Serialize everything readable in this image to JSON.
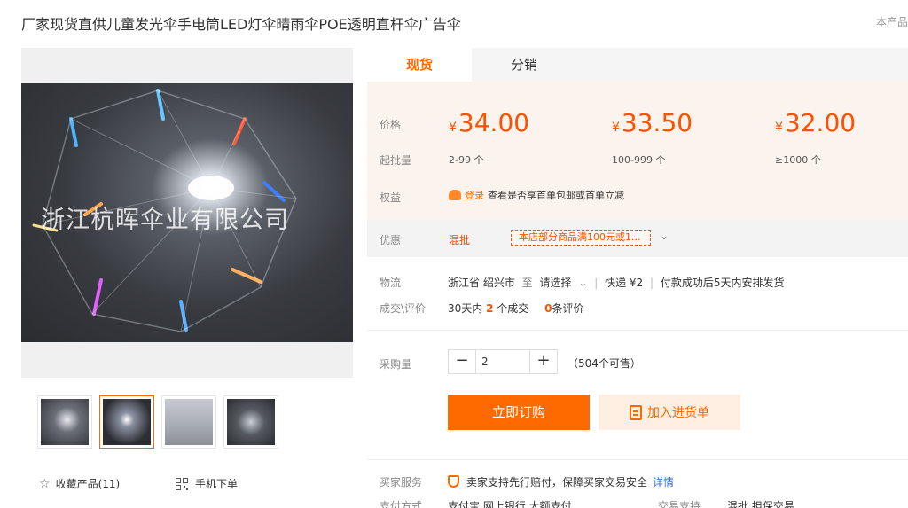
{
  "page": {
    "title": "厂家现货直供儿童发光伞手电筒LED灯伞晴雨伞POE透明直杆伞广告伞",
    "title_right": "本产品"
  },
  "gallery": {
    "watermark": "浙江杭晖伞业有限公司",
    "thumbnail_count": 4,
    "active_thumbnail": 2,
    "collect_label": "收藏产品(11)",
    "mobile_label": "手机下单"
  },
  "tabs": [
    {
      "label": "现货",
      "active": true
    },
    {
      "label": "分销",
      "active": false
    }
  ],
  "pricing": {
    "price_label": "价格",
    "moq_label": "起批量",
    "currency": "¥",
    "tiers": [
      {
        "price": "34.00",
        "range": "2-99 个"
      },
      {
        "price": "33.50",
        "range": "100-999 个"
      },
      {
        "price": "32.00",
        "range": "≥1000 个"
      }
    ],
    "benefit_label": "权益",
    "benefit_login": "登录",
    "benefit_text": "查看是否享首单包邮或首单立减"
  },
  "promo": {
    "label": "优惠",
    "tag": "混批",
    "box_text": "本店部分商品满100元或1..."
  },
  "logistics": {
    "label": "物流",
    "origin": "浙江省 绍兴市",
    "to": "至",
    "destination": "请选择",
    "express": "快递 ¥2",
    "ship_note": "付款成功后5天内安排发货"
  },
  "deals": {
    "label": "成交\\评价",
    "prefix": "30天内",
    "count": "2",
    "count_suffix": "个成交",
    "reviews": "0",
    "reviews_suffix": "条评价"
  },
  "purchase": {
    "label": "采购量",
    "minus": "−",
    "quantity": "2",
    "plus": "+",
    "stock": "（504个可售）"
  },
  "actions": {
    "buy_now": "立即订购",
    "add_to_list": "加入进货单"
  },
  "service": {
    "label": "买家服务",
    "text": "卖家支持先行赔付，保障买家交易安全",
    "detail": "详情"
  },
  "payment": {
    "label": "支付方式",
    "methods": "支付宝  网上银行  大额支付",
    "trade_label": "交易支持",
    "trade_value": "混批  担保交易"
  },
  "colors": {
    "accent": "#ff6a00",
    "price": "#ff5000",
    "price_panel_bg": "#fbf3ed"
  }
}
